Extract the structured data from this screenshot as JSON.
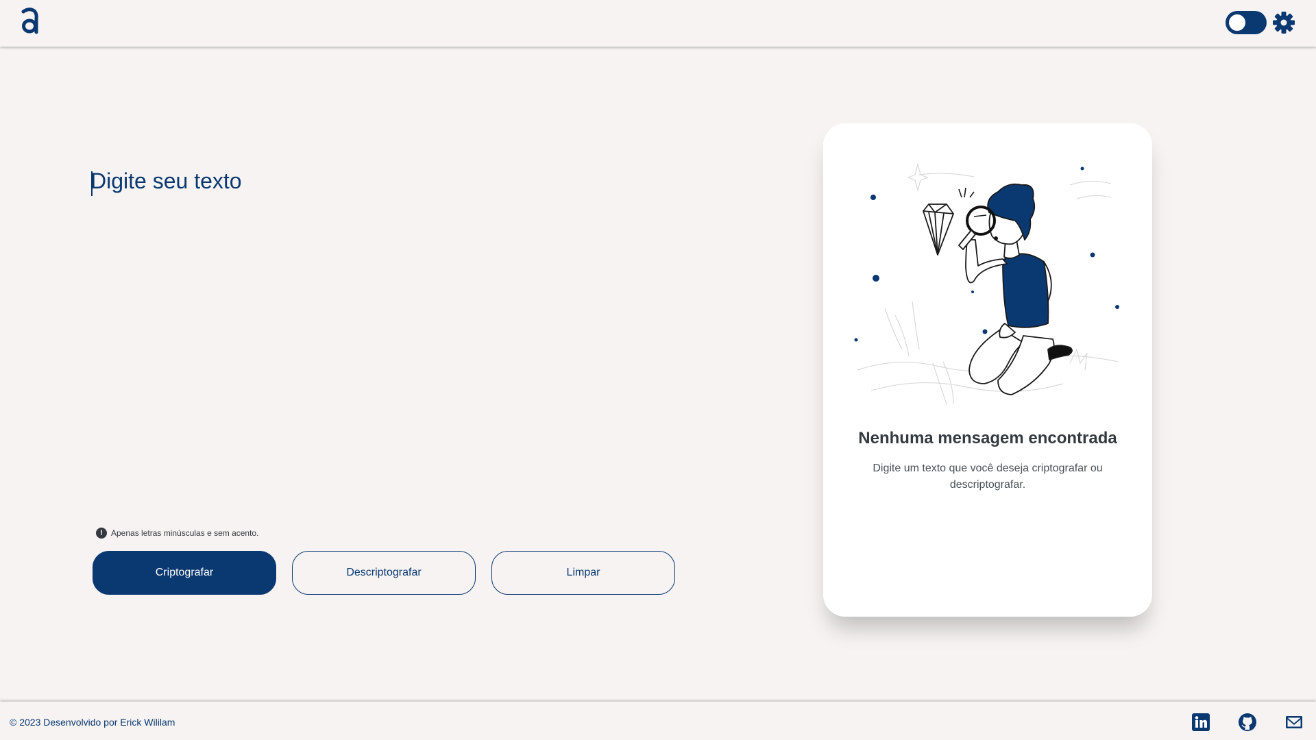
{
  "header": {
    "logo_icon": "alura-logo-icon",
    "theme_toggle_icon": "toggle-switch-icon",
    "settings_icon": "gear-icon"
  },
  "editor": {
    "placeholder": "Digite seu texto",
    "value": ""
  },
  "hint": {
    "icon": "info-icon",
    "icon_glyph": "!",
    "text": "Apenas letras minúsculas e sem acento."
  },
  "actions": {
    "encrypt_label": "Criptografar",
    "decrypt_label": "Descriptografar",
    "clear_label": "Limpar"
  },
  "output": {
    "illustration": "person-with-magnifying-glass-and-diamond-illustration",
    "title": "Nenhuma mensagem encontrada",
    "description": "Digite um texto que você deseja criptografar ou descriptografar."
  },
  "footer": {
    "credit": "© 2023 Desenvolvido por Erick Wililam",
    "social_icons": [
      "linkedin-icon",
      "github-icon",
      "mail-icon"
    ]
  },
  "colors": {
    "primary": "#0a3871",
    "background": "#f6f3f2",
    "card": "#ffffff",
    "heading": "#343a40"
  }
}
